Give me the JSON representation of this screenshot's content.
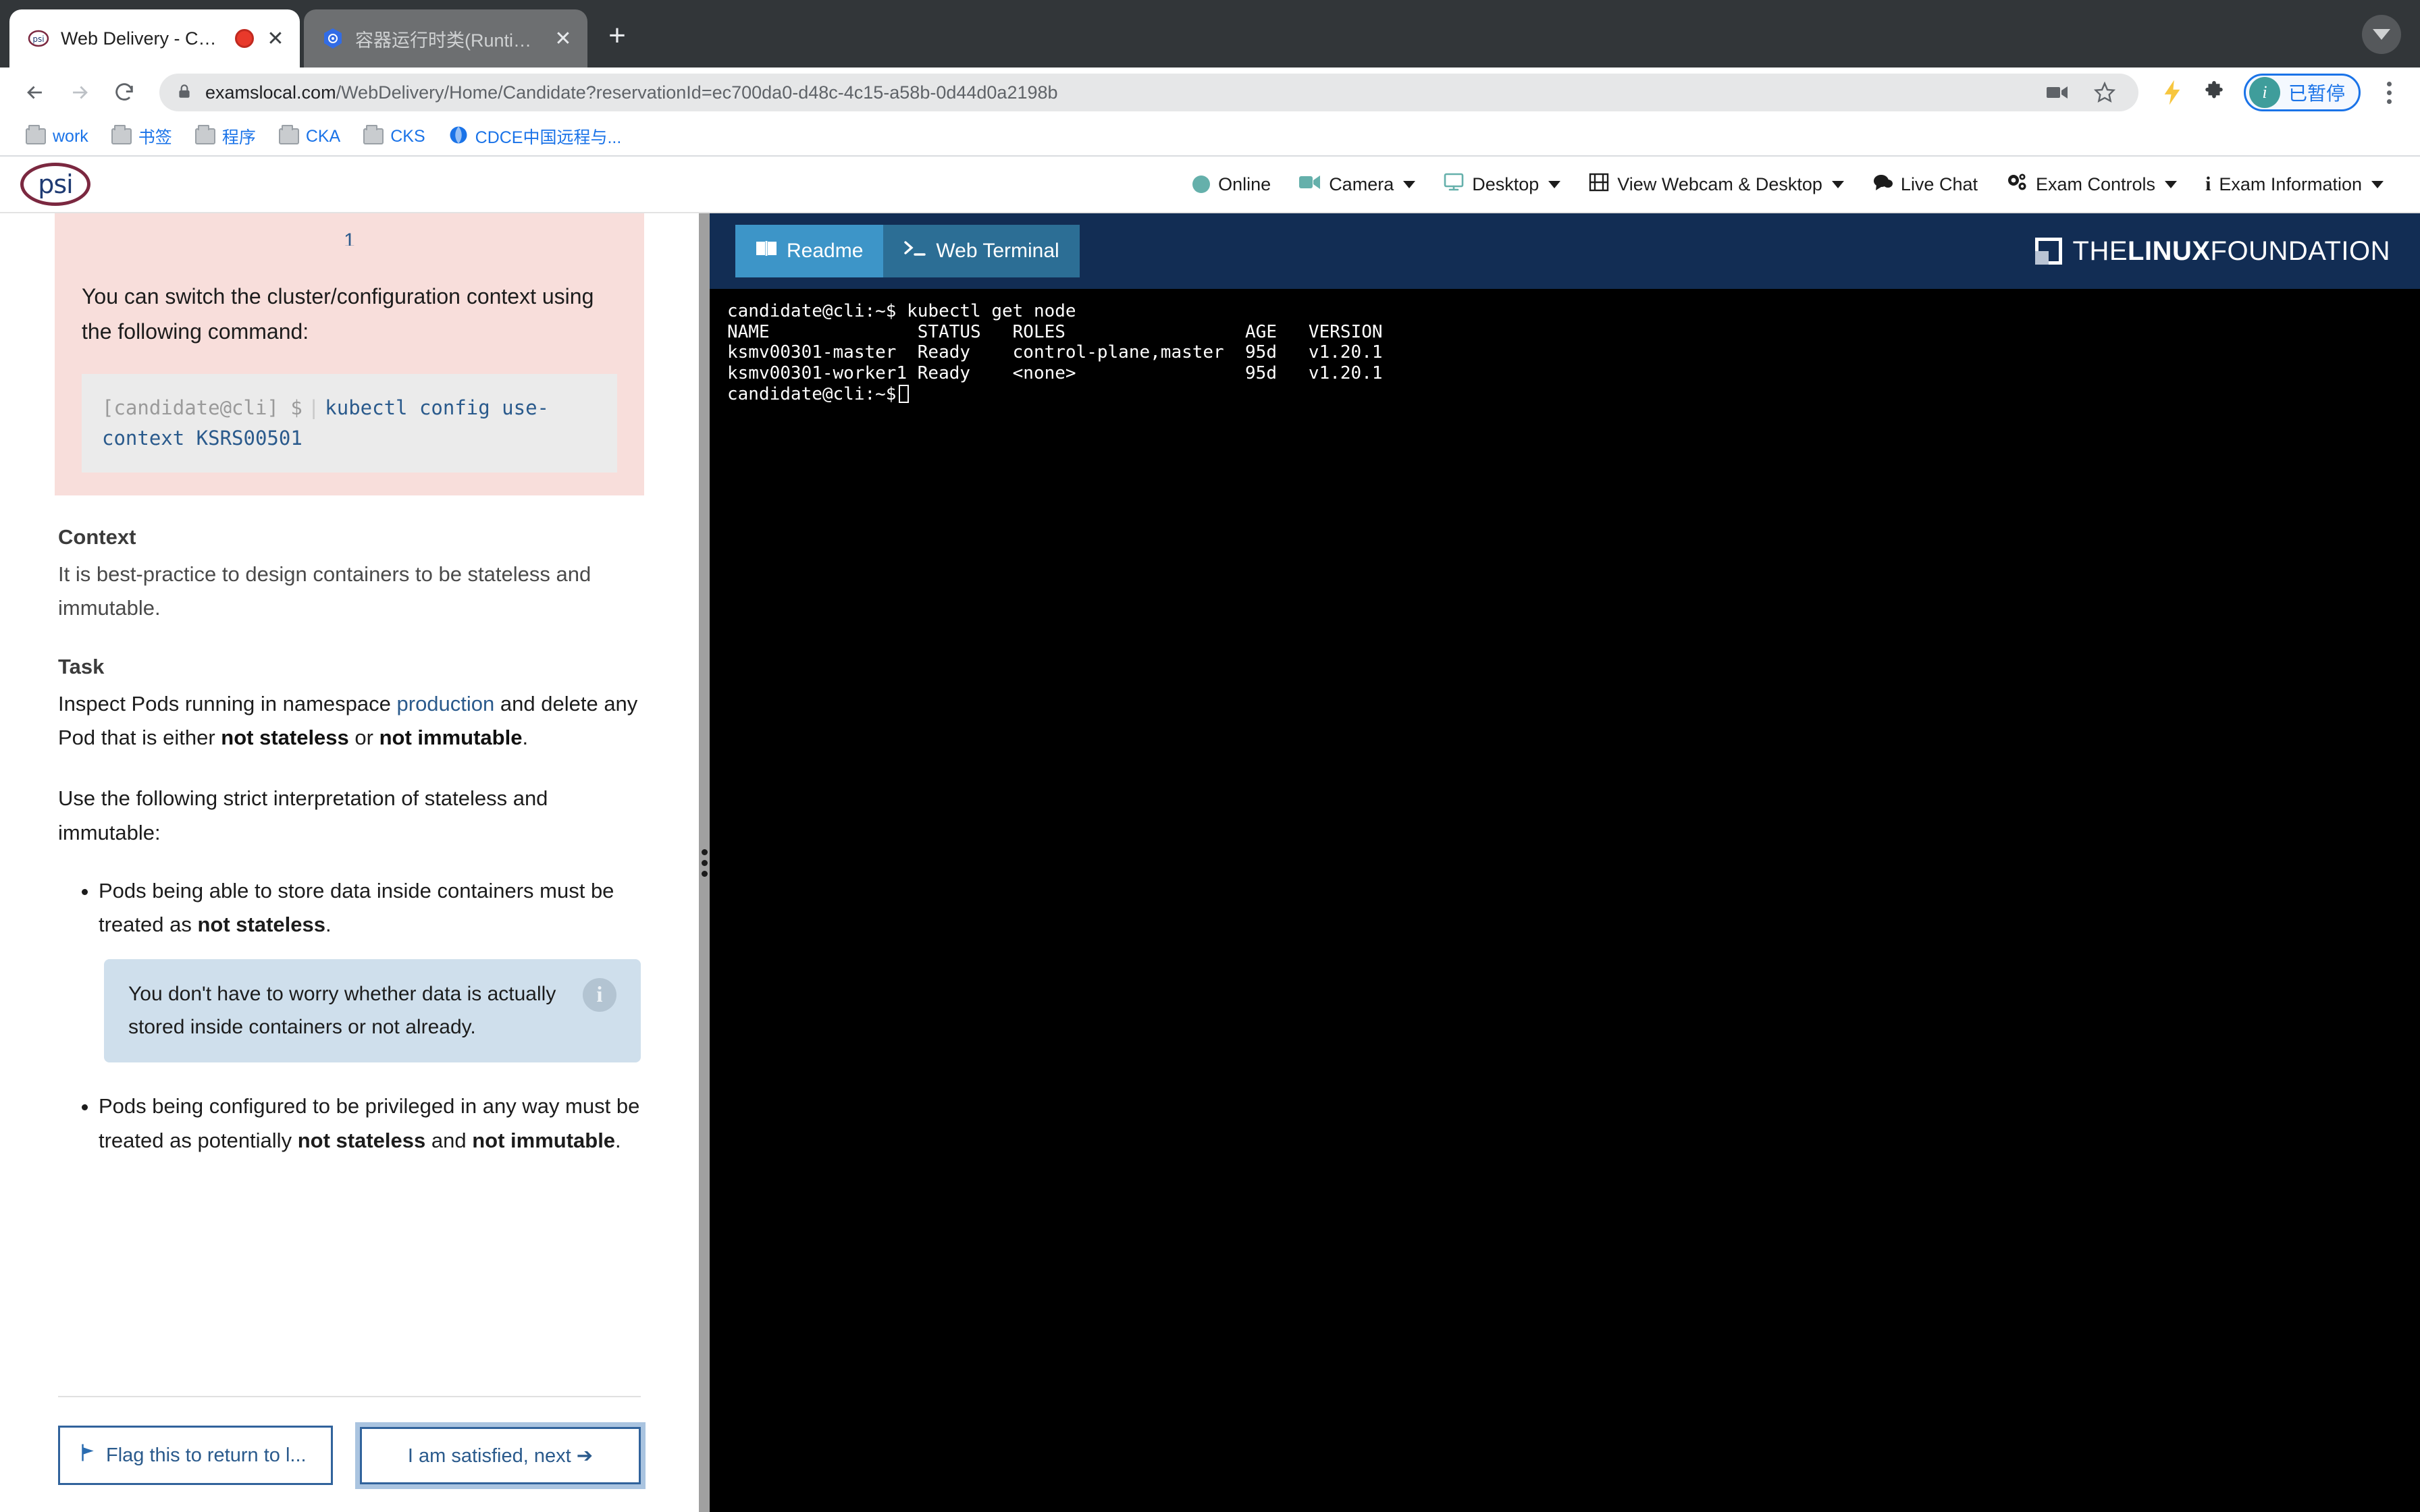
{
  "browser": {
    "tabs": [
      {
        "title": "Web Delivery - Candidate",
        "favicon": "psi-favicon",
        "recording": true,
        "active": true
      },
      {
        "title": "容器运行时类(Runtime Class) |",
        "favicon": "kubernetes-favicon",
        "recording": false,
        "active": false
      }
    ],
    "new_tab_label": "+",
    "close_label": "✕",
    "url_host": "examslocal.com",
    "url_path": "/WebDelivery/Home/Candidate?reservationId=ec700da0-d48c-4c15-a58b-0d44d0a2198b",
    "profile_pill": {
      "initial": "i",
      "label": "已暂停"
    },
    "bookmarks": [
      {
        "label": "work",
        "icon": "folder-icon"
      },
      {
        "label": "书签",
        "icon": "folder-icon"
      },
      {
        "label": "程序",
        "icon": "folder-icon"
      },
      {
        "label": "CKA",
        "icon": "folder-icon"
      },
      {
        "label": "CKS",
        "icon": "folder-icon"
      },
      {
        "label": "CDCE中国远程与...",
        "icon": "globe-icon"
      }
    ]
  },
  "psi_bar": {
    "logo_text": "psi",
    "items": [
      {
        "label": "Online",
        "icon": "status-dot-icon",
        "caret": false
      },
      {
        "label": "Camera",
        "icon": "camera-icon",
        "caret": true
      },
      {
        "label": "Desktop",
        "icon": "monitor-icon",
        "caret": true
      },
      {
        "label": "View Webcam & Desktop",
        "icon": "film-icon",
        "caret": true
      },
      {
        "label": "Live Chat",
        "icon": "chat-icon",
        "caret": false
      },
      {
        "label": "Exam Controls",
        "icon": "gears-icon",
        "caret": true
      },
      {
        "label": "Exam Information",
        "icon": "info-icon",
        "caret": true
      }
    ]
  },
  "readme": {
    "question_number": "1",
    "callout_text": "You can switch the cluster/configuration context using the following command:",
    "code_prompt": "[candidate@cli] $",
    "code_command": "kubectl config use-context KSRS00501",
    "context_heading": "Context",
    "context_body": "It is best-practice to design containers to be stateless and immutable.",
    "task_heading": "Task",
    "task_line1_a": "Inspect Pods running in namespace",
    "task_namespace": "production",
    "task_line1_b": "and delete any Pod that is either",
    "task_bold1": "not stateless",
    "task_line1_c": "or",
    "task_bold2": "not immutable",
    "task_line1_d": ".",
    "task_intro": "Use the following strict interpretation of stateless and immutable:",
    "bullets": [
      {
        "text_a": "Pods being able to store data inside containers must be treated as",
        "bold_a": "not stateless",
        "text_b": "."
      },
      {
        "text_a": "Pods being configured to be privileged in any way must be treated as potentially",
        "bold_a": "not stateless",
        "text_b": "and",
        "bold_b": "not immutable",
        "text_c": "."
      }
    ],
    "info_note": "You don't have to worry whether data is actually stored inside containers or not already.",
    "info_icon_glyph": "i",
    "flag_button": "Flag this to return to l...",
    "flag_icon": "flag-icon",
    "next_button": "I am satisfied, next ➔"
  },
  "terminal": {
    "tabs": [
      {
        "label": "Readme",
        "icon": "book-icon",
        "selected": true
      },
      {
        "label": "Web Terminal",
        "icon": "prompt-icon",
        "selected": false
      }
    ],
    "brand_mark": "linux-foundation-logo",
    "brand_the": "THE",
    "brand_linux": "LINUX",
    "brand_foundation": "FOUNDATION",
    "lines": [
      "candidate@cli:~$ kubectl get node",
      "NAME              STATUS   ROLES                 AGE   VERSION",
      "ksmv00301-master  Ready    control-plane,master  95d   v1.20.1",
      "ksmv00301-worker1 Ready    <none>                95d   v1.20.1"
    ],
    "prompt_last": "candidate@cli:~$"
  },
  "colors": {
    "psi_accent": "#7b2840",
    "link": "#2a5a8c",
    "callout_bg": "#f8dedb",
    "info_bg": "#cfdfec",
    "term_header_bg": "#122d54",
    "tab_selected": "#3d95c8"
  }
}
